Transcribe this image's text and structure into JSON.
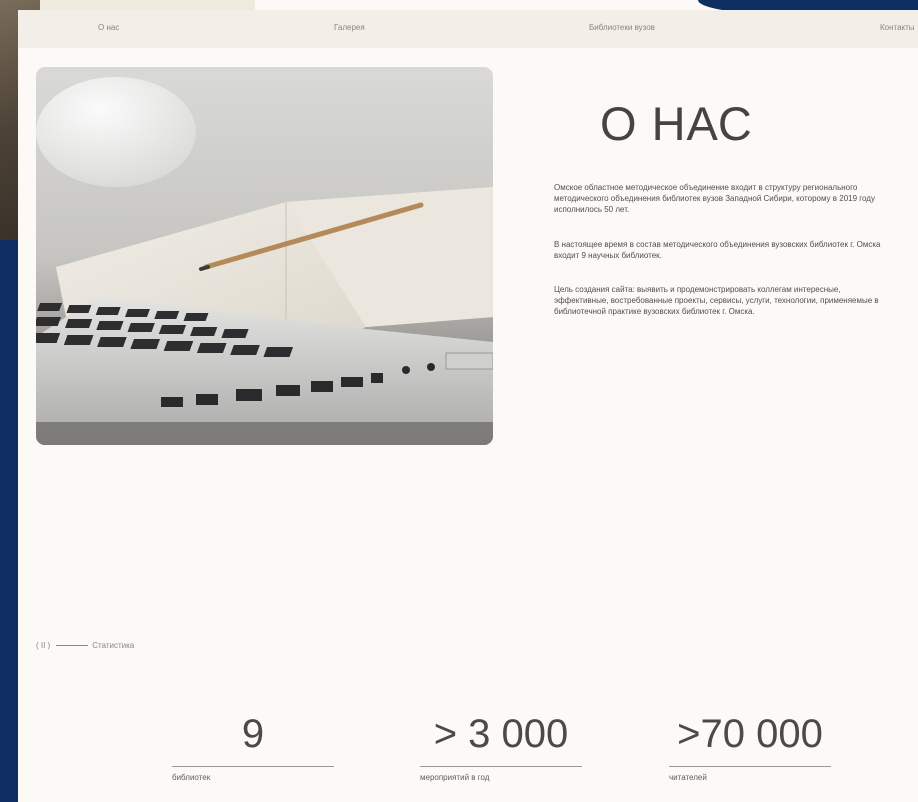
{
  "nav": {
    "items": [
      "О нас",
      "Галерея",
      "Библиотеки вузов",
      "Контакты"
    ]
  },
  "about": {
    "title": "О НАС",
    "paragraphs": [
      "Омское областное методическое объединение входит в структуру регионального методического объединения библиотек вузов Западной Сибири, которому в 2019 году исполнилось 50 лет.",
      "В настоящее время в состав методического объединения вузовских библиотек г. Омска входит 9 научных библиотек.",
      "Цель создания сайта: выявить и продемонстрировать коллегам интересные, эффективные, востребованные проекты, сервисы, услуги, технологии, применяемые в библиотечной практике вузовских библиотек г. Омска."
    ]
  },
  "stats_section": {
    "number": "( II )",
    "label": "Статистика"
  },
  "stats": [
    {
      "value": "9",
      "label": "библиотек"
    },
    {
      "value": "> 3 000",
      "label": "мероприятий в год"
    },
    {
      "value": ">70 000",
      "label": "читателей"
    }
  ],
  "colors": {
    "background": "#fcf9f6",
    "accent_blue": "#0f2f63",
    "text_dark": "#444444",
    "text_muted": "#8a8580"
  }
}
